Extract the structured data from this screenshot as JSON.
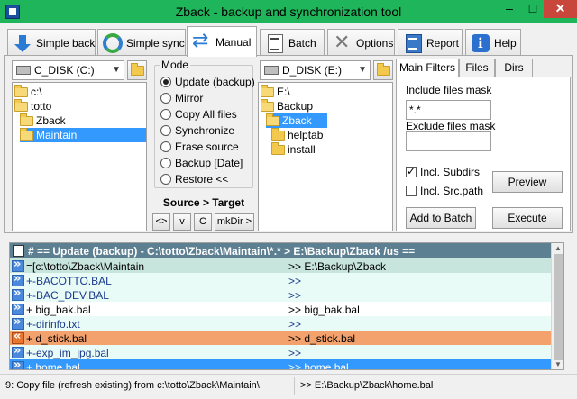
{
  "window": {
    "title": "Zback - backup and synchronization tool",
    "minimize": "–",
    "maximize": "□",
    "close": "✕"
  },
  "toolbar": {
    "tabs": [
      {
        "label": "Simple back",
        "icon": "arrow-down-icon"
      },
      {
        "label": "Simple sync",
        "icon": "sync-icon"
      },
      {
        "label": "Manual",
        "icon": "swap-arrows-icon",
        "active": true
      },
      {
        "label": "Batch",
        "icon": "batch-document-icon"
      },
      {
        "label": "Options",
        "icon": "tools-icon"
      },
      {
        "label": "Report",
        "icon": "report-icon"
      },
      {
        "label": "Help",
        "icon": "info-icon"
      }
    ]
  },
  "source": {
    "drive": "C_DISK (C:)",
    "tree": [
      {
        "label": "c:\\",
        "selected": false
      },
      {
        "label": "totto",
        "selected": false
      },
      {
        "label": "Zback",
        "selected": false
      },
      {
        "label": "Maintain",
        "selected": true
      }
    ]
  },
  "mode": {
    "legend": "Mode",
    "options": [
      {
        "label": "Update (backup)",
        "checked": true
      },
      {
        "label": "Mirror",
        "checked": false
      },
      {
        "label": "Copy All files",
        "checked": false
      },
      {
        "label": "Synchronize",
        "checked": false
      },
      {
        "label": "Erase source",
        "checked": false
      },
      {
        "label": "Backup [Date]",
        "checked": false
      },
      {
        "label": "Restore <<",
        "checked": false
      }
    ],
    "direction": "Source > Target",
    "buttons": [
      "<>",
      "v",
      "C",
      "mkDir >"
    ]
  },
  "target": {
    "drive": "D_DISK (E:)",
    "tree": [
      {
        "label": "E:\\",
        "selected": false
      },
      {
        "label": "Backup",
        "selected": false
      },
      {
        "label": "Zback",
        "selected": true
      },
      {
        "label": "helptab",
        "selected": false
      },
      {
        "label": "install",
        "selected": false
      }
    ]
  },
  "filters": {
    "tabs": [
      "Main Filters",
      "Files",
      "Dirs"
    ],
    "include_label": "Include files mask",
    "include_value": "*.*",
    "exclude_label": "Exclude files mask",
    "exclude_value": "",
    "incl_subdirs": "Incl. Subdirs",
    "incl_subdirs_checked": true,
    "incl_srcpath": "Incl. Src.path",
    "incl_srcpath_checked": false,
    "preview": "Preview",
    "add_to_batch": "Add to Batch",
    "execute": "Execute"
  },
  "log": {
    "header": "# == Update (backup) - C:\\totto\\Zback\\Maintain\\*.* >  E:\\Backup\\Zback  /us ==",
    "rows": [
      {
        "left": "=[c:\\totto\\Zback\\Maintain",
        "right": ">> E:\\Backup\\Zback",
        "style": "root",
        "icon": "forward"
      },
      {
        "left": "+-BACOTTO.BAL",
        "right": ">>",
        "style": "dir",
        "icon": "forward"
      },
      {
        "left": "+-BAC_DEV.BAL",
        "right": ">>",
        "style": "dir",
        "icon": "forward"
      },
      {
        "left": "+ big_bak.bal",
        "right": ">> big_bak.bal",
        "style": "file",
        "icon": "forward"
      },
      {
        "left": "+-dirinfo.txt",
        "right": ">>",
        "style": "dir",
        "icon": "forward"
      },
      {
        "left": "+ d_stick.bal",
        "right": ">> d_stick.bal",
        "style": "restore",
        "icon": "back"
      },
      {
        "left": "+-exp_im_jpg.bal",
        "right": ">>",
        "style": "dir",
        "icon": "forward"
      },
      {
        "left": "+ home.bal",
        "right": ">> home.bal",
        "style": "selected",
        "icon": "forward"
      }
    ]
  },
  "status": {
    "left": "9: Copy file (refresh existing) from c:\\totto\\Zback\\Maintain\\",
    "right": ">> E:\\Backup\\Zback\\home.bal"
  }
}
